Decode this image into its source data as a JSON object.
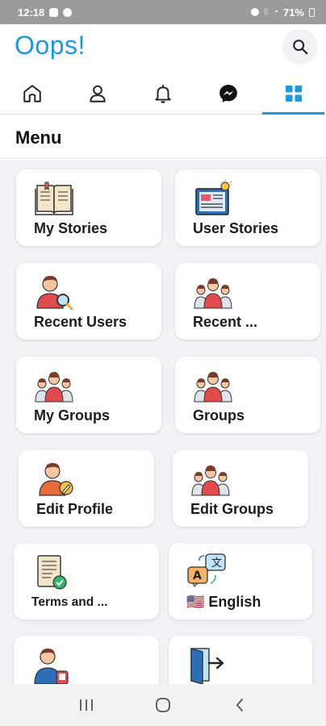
{
  "status_bar": {
    "time": "12:18",
    "battery": "71%"
  },
  "app": {
    "title": "Oops!"
  },
  "tabs": [
    {
      "name": "home"
    },
    {
      "name": "profile"
    },
    {
      "name": "notifications"
    },
    {
      "name": "messenger"
    },
    {
      "name": "menu",
      "active": true
    }
  ],
  "menu": {
    "title": "Menu",
    "items": [
      {
        "label": "My Stories",
        "icon": "book-icon"
      },
      {
        "label": "User Stories",
        "icon": "newspaper-icon"
      },
      {
        "label": "Recent Users",
        "icon": "user-search-icon"
      },
      {
        "label": "Recent ...",
        "icon": "people-group-icon"
      },
      {
        "label": "My Groups",
        "icon": "people-group-icon"
      },
      {
        "label": "Groups",
        "icon": "people-group-icon"
      },
      {
        "label": "Edit Profile",
        "icon": "user-edit-icon"
      },
      {
        "label": "Edit Groups",
        "icon": "people-group-icon"
      },
      {
        "label": "Terms and ...",
        "icon": "document-check-icon"
      },
      {
        "label": "🇺🇸 English",
        "icon": "translate-icon"
      },
      {
        "label": "",
        "icon": "user-phone-icon"
      },
      {
        "label": "",
        "icon": "logout-door-icon"
      }
    ]
  },
  "colors": {
    "accent": "#1a9ae0",
    "background": "#f0f2f5"
  }
}
